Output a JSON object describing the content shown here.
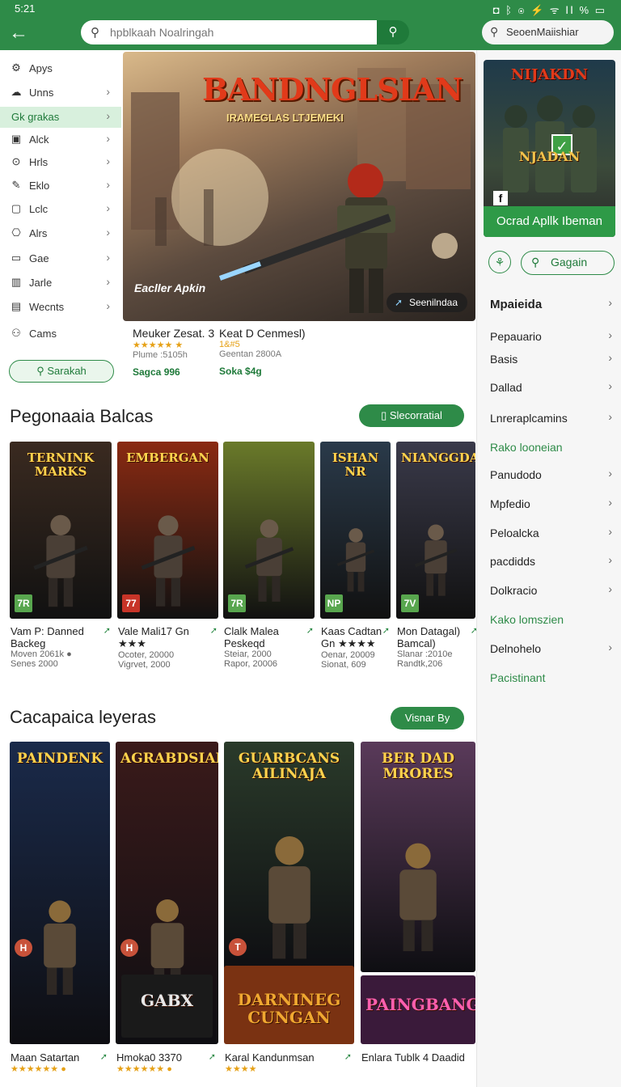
{
  "status": {
    "time": "5:21",
    "icons": "◘ ᛒ ◉ ⚡ ᯤ ⅠⅠ % ▭"
  },
  "header": {
    "search_placeholder": "hpblkaah Noalringah",
    "right_search": "SeoenMaiishiar"
  },
  "sidebar": {
    "items": [
      {
        "label": "Apys",
        "icon": "gear-icon",
        "glyph": "⚙",
        "chevron": false
      },
      {
        "label": "Unns",
        "icon": "cloud-icon",
        "glyph": "☁",
        "chevron": true
      },
      {
        "label": "Gk grakas",
        "icon": "",
        "glyph": "",
        "chevron": true,
        "active": true
      },
      {
        "label": "Alck",
        "icon": "game-icon",
        "glyph": "▣",
        "chevron": true
      },
      {
        "label": "Hrls",
        "icon": "pin-icon",
        "glyph": "⊙",
        "chevron": true
      },
      {
        "label": "Eklo",
        "icon": "wrench-icon",
        "glyph": "✎",
        "chevron": true
      },
      {
        "label": "Lclc",
        "icon": "square-icon",
        "glyph": "▢",
        "chevron": true
      },
      {
        "label": "Alrs",
        "icon": "lock-icon",
        "glyph": "⎔",
        "chevron": true
      },
      {
        "label": "Gae",
        "icon": "box-icon",
        "glyph": "▭",
        "chevron": true
      },
      {
        "label": "Jarle",
        "icon": "book-icon",
        "glyph": "▥",
        "chevron": true
      },
      {
        "label": "Wecnts",
        "icon": "calendar-icon",
        "glyph": "▤",
        "chevron": true
      },
      {
        "label": "Cams",
        "icon": "people-icon",
        "glyph": "⚇",
        "chevron": false
      }
    ],
    "button_label": "Sarakah"
  },
  "hero": {
    "title": "BANDNGLSIAN",
    "subtitle": "IRAMEGLAS LTJEMEKI",
    "logo": "Eacller Apkin",
    "chip": "Seenilndaa",
    "items": [
      {
        "name": "Meuker Zesat. 3",
        "stars": "★★★★★ ★",
        "sub": "Plume :5105h",
        "tag": "Sagca 996"
      },
      {
        "name": "Keat D Cenmesl)",
        "stars": "1&#5",
        "sub": "Geentan 2800A",
        "tag": "Soka $4g"
      }
    ]
  },
  "section1": {
    "title": "Pegonaaia Balcas",
    "button": "Slecorratial",
    "cards": [
      {
        "art": "TERNINK MARKS",
        "badge": "7R",
        "name": "Vam P: Danned Backeg",
        "sub1": "Moven 2061k ●",
        "sub2": "Senes 2000",
        "bg": "#3a2a20"
      },
      {
        "art": "EMBERGAN",
        "badge": "77",
        "name": "Vale Mali17 Gn ★★★",
        "sub1": "Ocoter, 20000",
        "sub2": "Vigrvet, 2000",
        "bg": "#8a2a12"
      },
      {
        "art": "",
        "badge": "7R",
        "name": "Clalk Malea Peskeqd",
        "sub1": "Steiar, 2000",
        "sub2": "Rapor, 20006",
        "bg": "#6a7a2a"
      },
      {
        "art": "ISHAN NR",
        "badge": "NP",
        "name": "Kaas Cadtan Gn ★★★★",
        "sub1": "Oenar, 20009",
        "sub2": "Sionat, 609",
        "bg": "#2a3a4a"
      },
      {
        "art": "NIANGGDA",
        "badge": "7V",
        "name": "Mon Datagal) Bamcal)",
        "sub1": "Slanar :2010e",
        "sub2": "Randtk,206",
        "bg": "#3a3a4a"
      }
    ]
  },
  "section2": {
    "title": "Cacapaica leyeras",
    "button": "Visnar By",
    "cards": [
      {
        "art": "PAINDENK",
        "badge": "H",
        "name": "Maan Satartan",
        "stars": "★★★★★★ ●",
        "bg": "#1a2a4a"
      },
      {
        "art": "AGRABDSIAN",
        "badge": "H",
        "name": "Hmoka0 3370",
        "stars": "★★★★★★ ●",
        "bg": "#3a1a1a"
      },
      {
        "art": "GUARBCANS AILINAJA",
        "badge": "T",
        "name": "Karal Kandunmsan",
        "stars": "★★★★",
        "bg": "#2a3a2a"
      },
      {
        "art": "BER DAD MRORES",
        "badge": "",
        "name": "Enlara Tublk 4 Daadid",
        "stars": "",
        "bg": "#5a3a5a"
      }
    ],
    "extra_art": [
      "GABX",
      "DARNINEG CUNGAN",
      "PAINGBANG"
    ]
  },
  "right": {
    "promo_title": "NIJAKDN",
    "promo_title2": "NJADAN",
    "promo_bar": "Ocrad Apllk Ibeman",
    "gagain": "Gagain",
    "list": [
      {
        "label": "Mpaieida",
        "chevron": true,
        "kind": "head"
      },
      {
        "label": "Pepauario",
        "chevron": true,
        "kind": ""
      },
      {
        "label": "Basis",
        "chevron": true,
        "kind": ""
      },
      {
        "label": "Dallad",
        "chevron": true,
        "kind": ""
      },
      {
        "label": "Lnreraplcamins",
        "chevron": true,
        "kind": ""
      },
      {
        "label": "Rako looneian",
        "chevron": false,
        "kind": "green"
      },
      {
        "label": "Panudodo",
        "chevron": true,
        "kind": ""
      },
      {
        "label": "Mpfedio",
        "chevron": true,
        "kind": ""
      },
      {
        "label": "Peloalcka",
        "chevron": true,
        "kind": ""
      },
      {
        "label": "pacdidds",
        "chevron": true,
        "kind": ""
      },
      {
        "label": "Dolkracio",
        "chevron": true,
        "kind": ""
      },
      {
        "label": "Kako lomszien",
        "chevron": false,
        "kind": "green"
      },
      {
        "label": "Delnohelo",
        "chevron": true,
        "kind": ""
      },
      {
        "label": "Pacistinant",
        "chevron": false,
        "kind": "green"
      }
    ]
  }
}
